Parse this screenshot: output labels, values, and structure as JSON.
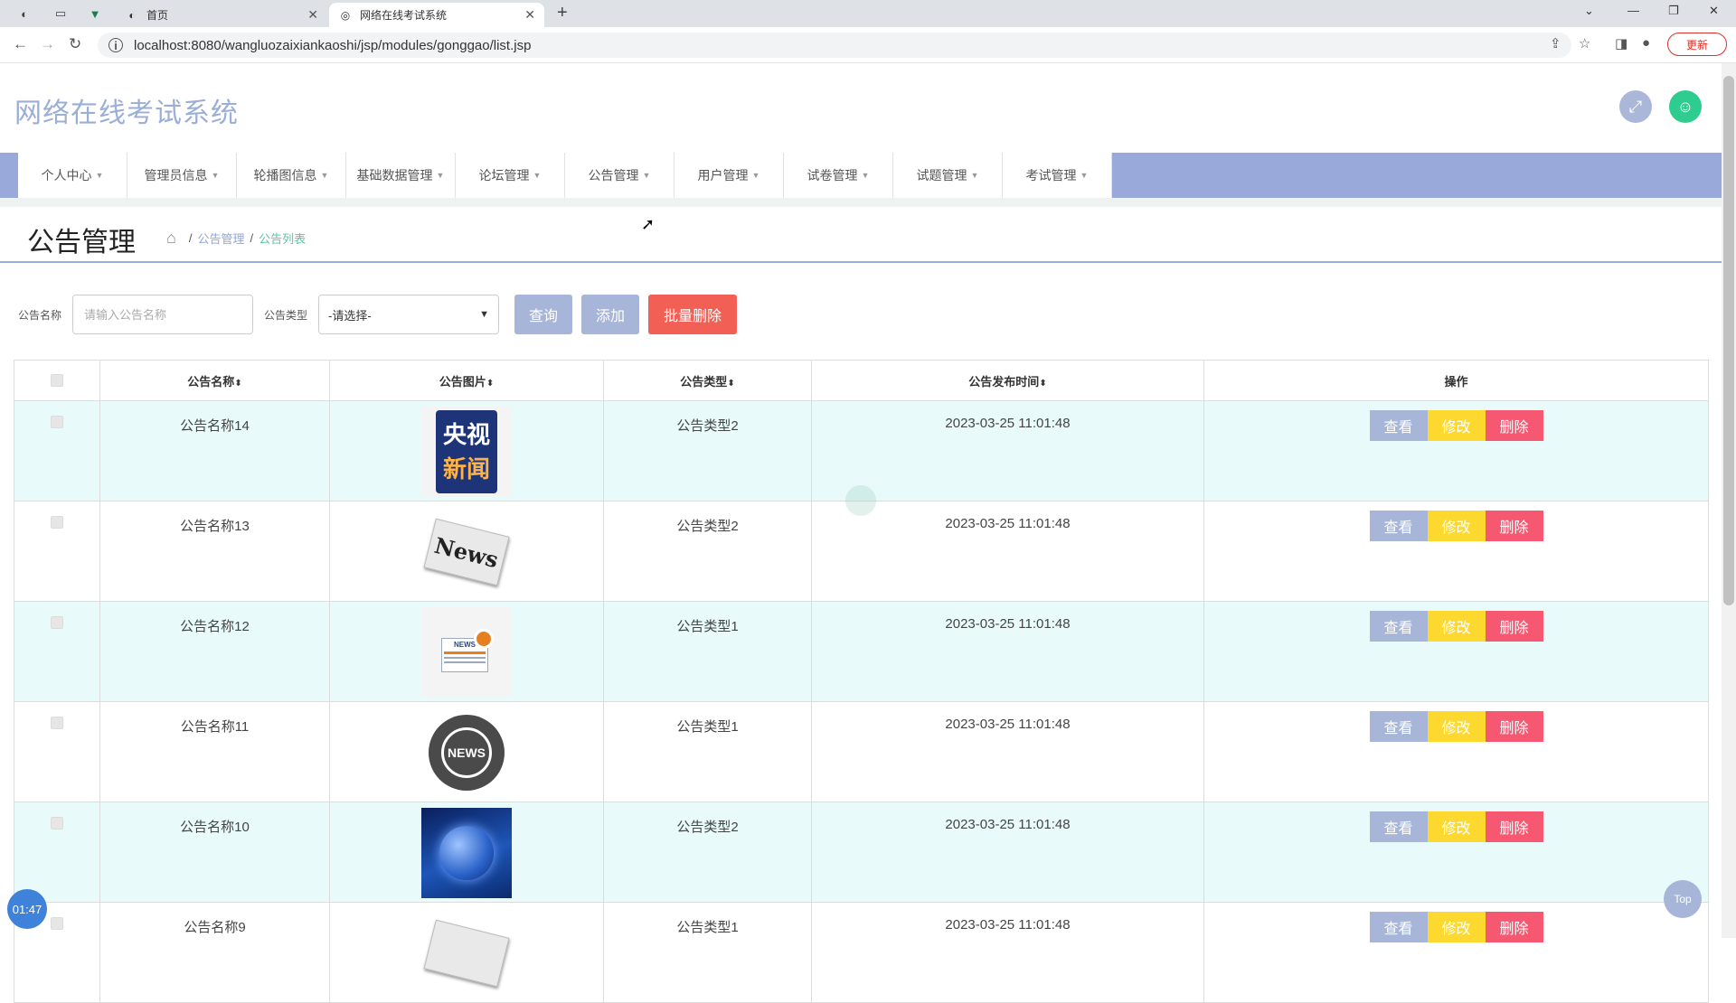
{
  "browser": {
    "tabs": [
      {
        "title": "首页"
      },
      {
        "title": "网络在线考试系统"
      }
    ],
    "url": "localhost:8080/wangluozaixiankaoshi/jsp/modules/gonggao/list.jsp",
    "update_label": "更新"
  },
  "app": {
    "title": "网络在线考试系统",
    "menu": [
      {
        "label": "个人中心"
      },
      {
        "label": "管理员信息"
      },
      {
        "label": "轮播图信息"
      },
      {
        "label": "基础数据管理"
      },
      {
        "label": "论坛管理"
      },
      {
        "label": "公告管理"
      },
      {
        "label": "用户管理"
      },
      {
        "label": "试卷管理"
      },
      {
        "label": "试题管理"
      },
      {
        "label": "考试管理"
      }
    ]
  },
  "page": {
    "title": "公告管理",
    "breadcrumb": {
      "level1": "公告管理",
      "level2": "公告列表"
    }
  },
  "search": {
    "name_label": "公告名称",
    "name_placeholder": "请输入公告名称",
    "type_label": "公告类型",
    "type_selected": "-请选择-",
    "query_label": "查询",
    "add_label": "添加",
    "batch_delete_label": "批量删除"
  },
  "table": {
    "headers": {
      "name": "公告名称",
      "image": "公告图片",
      "type": "公告类型",
      "time": "公告发布时间",
      "ops": "操作"
    },
    "actions": {
      "view": "查看",
      "edit": "修改",
      "delete": "删除"
    },
    "rows": [
      {
        "name": "公告名称14",
        "image": "cctv-news-logo",
        "type": "公告类型2",
        "time": "2023-03-25 11:01:48",
        "logo_line1": "央视",
        "logo_line2": "新闻"
      },
      {
        "name": "公告名称13",
        "image": "newspaper-news",
        "type": "公告类型2",
        "time": "2023-03-25 11:01:48",
        "logo_text": "News"
      },
      {
        "name": "公告名称12",
        "image": "news-illustration",
        "type": "公告类型1",
        "time": "2023-03-25 11:01:48",
        "logo_text": "NEWS"
      },
      {
        "name": "公告名称11",
        "image": "news-globe-badge",
        "type": "公告类型1",
        "time": "2023-03-25 11:01:48",
        "logo_text": "NEWS"
      },
      {
        "name": "公告名称10",
        "image": "globe-studio",
        "type": "公告类型2",
        "time": "2023-03-25 11:01:48"
      },
      {
        "name": "公告名称9",
        "image": "newspaper-news",
        "type": "公告类型1",
        "time": "2023-03-25 11:01:48"
      }
    ]
  },
  "floating": {
    "timer": "01:47",
    "top_label": "Top"
  }
}
